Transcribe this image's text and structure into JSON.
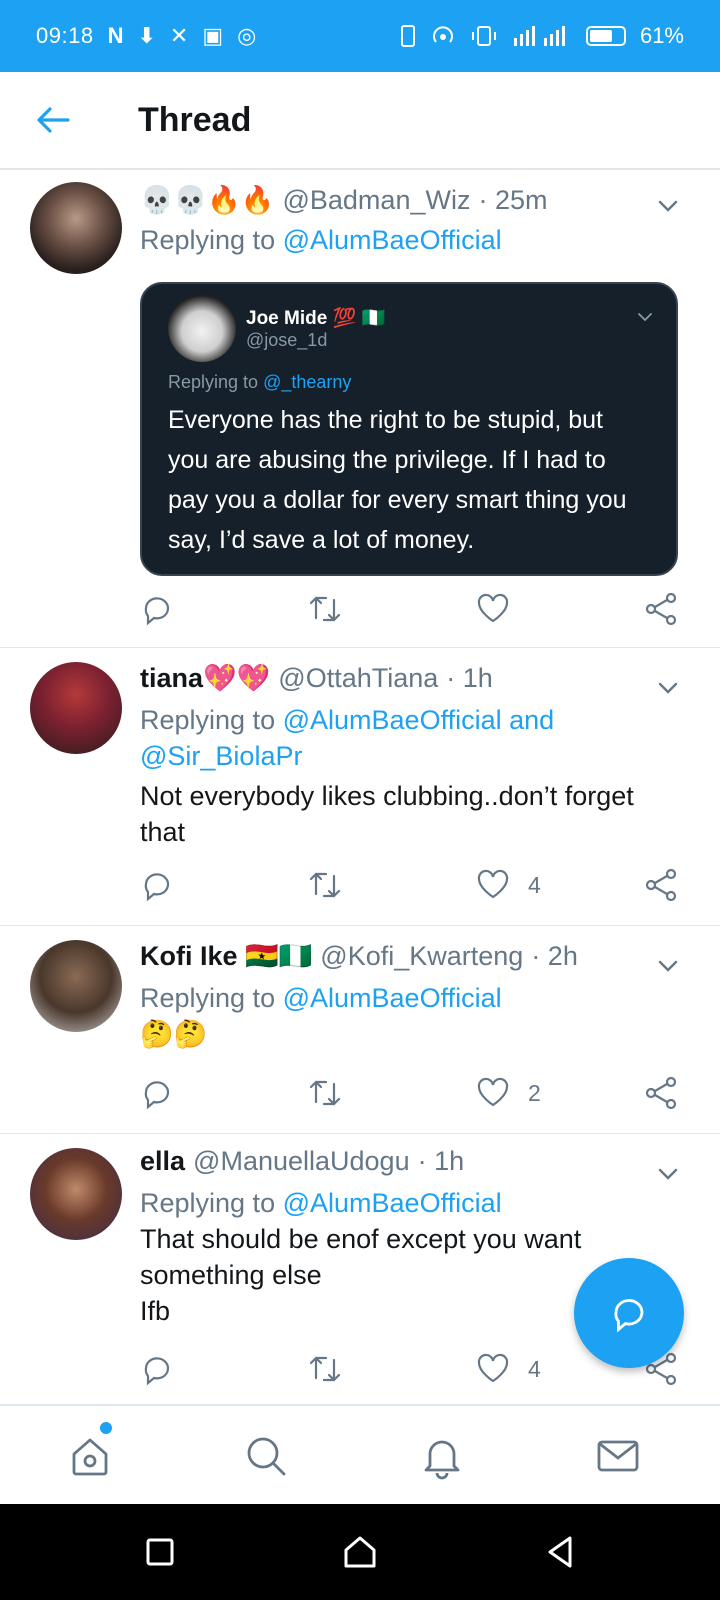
{
  "status_bar": {
    "time": "09:18",
    "left_icons": [
      "N",
      "⬇",
      "✕",
      "▣",
      "◎"
    ],
    "battery": "61%"
  },
  "header": {
    "title": "Thread"
  },
  "tweets": [
    {
      "name_emoji": "💀💀🔥🔥",
      "handle": "@Badman_Wiz",
      "time": "· 25m",
      "replying_prefix": "Replying to",
      "replying_to": "@AlumBaeOfficial",
      "quote": {
        "name": "Joe Mide 💯 🇳🇬",
        "handle": "@jose_1d",
        "replying_prefix": "Replying to",
        "replying_to": "@_thearny",
        "text": "Everyone has the right to be stupid, but you are abusing the privilege. If I had to pay you a dollar for every smart thing you say, I’d save a lot of money."
      },
      "likes": ""
    },
    {
      "name": "tiana",
      "name_emoji": "💖💖",
      "handle": "@OttahTiana",
      "time": "· 1h",
      "replying_prefix": "Replying to",
      "replying_to": "@AlumBaeOfficial and @Sir_BiolaPr",
      "text": "Not everybody likes clubbing..don’t forget that",
      "likes": "4"
    },
    {
      "name": "Kofi Ike",
      "name_emoji": "🇬🇭🇳🇬",
      "handle": "@Kofi_Kwarteng",
      "time": "· 2h",
      "replying_prefix": "Replying to",
      "replying_to": "@AlumBaeOfficial",
      "text": "🤔🤔",
      "likes": "2"
    },
    {
      "name": "ella",
      "handle": "@ManuellaUdogu",
      "time": "· 1h",
      "replying_prefix": "Replying to",
      "replying_to": "@AlumBaeOfficial",
      "text_line1": "That should be enof except you want",
      "text_line2": "something else",
      "text_line3": "Ifb",
      "likes": "4"
    }
  ],
  "colors": {
    "accent": "#1da1f2",
    "text": "#14171a",
    "muted": "#657786",
    "quote_bg": "#15202b"
  },
  "icons": {
    "back": "back-arrow-icon",
    "reply": "reply-icon",
    "retweet": "retweet-icon",
    "like": "heart-icon",
    "share": "share-icon",
    "fab": "compose-reply-icon",
    "tabs": [
      "home-icon",
      "search-icon",
      "notifications-icon",
      "messages-icon"
    ]
  }
}
